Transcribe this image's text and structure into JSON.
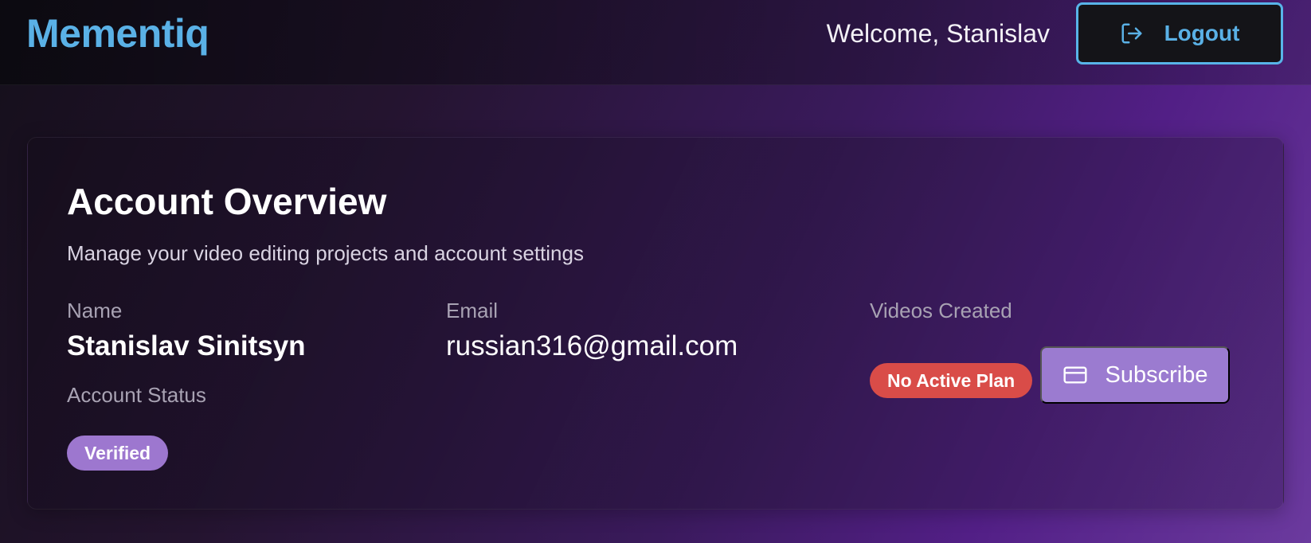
{
  "header": {
    "brand": "Mementiq",
    "welcome_text": "Welcome, Stanislav",
    "logout_label": "Logout",
    "logout_icon": "logout-icon"
  },
  "account": {
    "title": "Account Overview",
    "subtitle": "Manage your video editing projects and account settings",
    "fields": {
      "name_label": "Name",
      "name_value": "Stanislav Sinitsyn",
      "email_label": "Email",
      "email_value": "russian316@gmail.com",
      "videos_label": "Videos Created",
      "status_label": "Account Status"
    },
    "status_badge": "Verified",
    "plan_badge": "No Active Plan",
    "subscribe_label": "Subscribe",
    "subscribe_icon": "credit-card-icon"
  },
  "colors": {
    "accent": "#5ab1e6",
    "verified_badge": "#9d77cf",
    "plan_badge": "#d94c48",
    "subscribe_button": "#9b7bd0"
  }
}
